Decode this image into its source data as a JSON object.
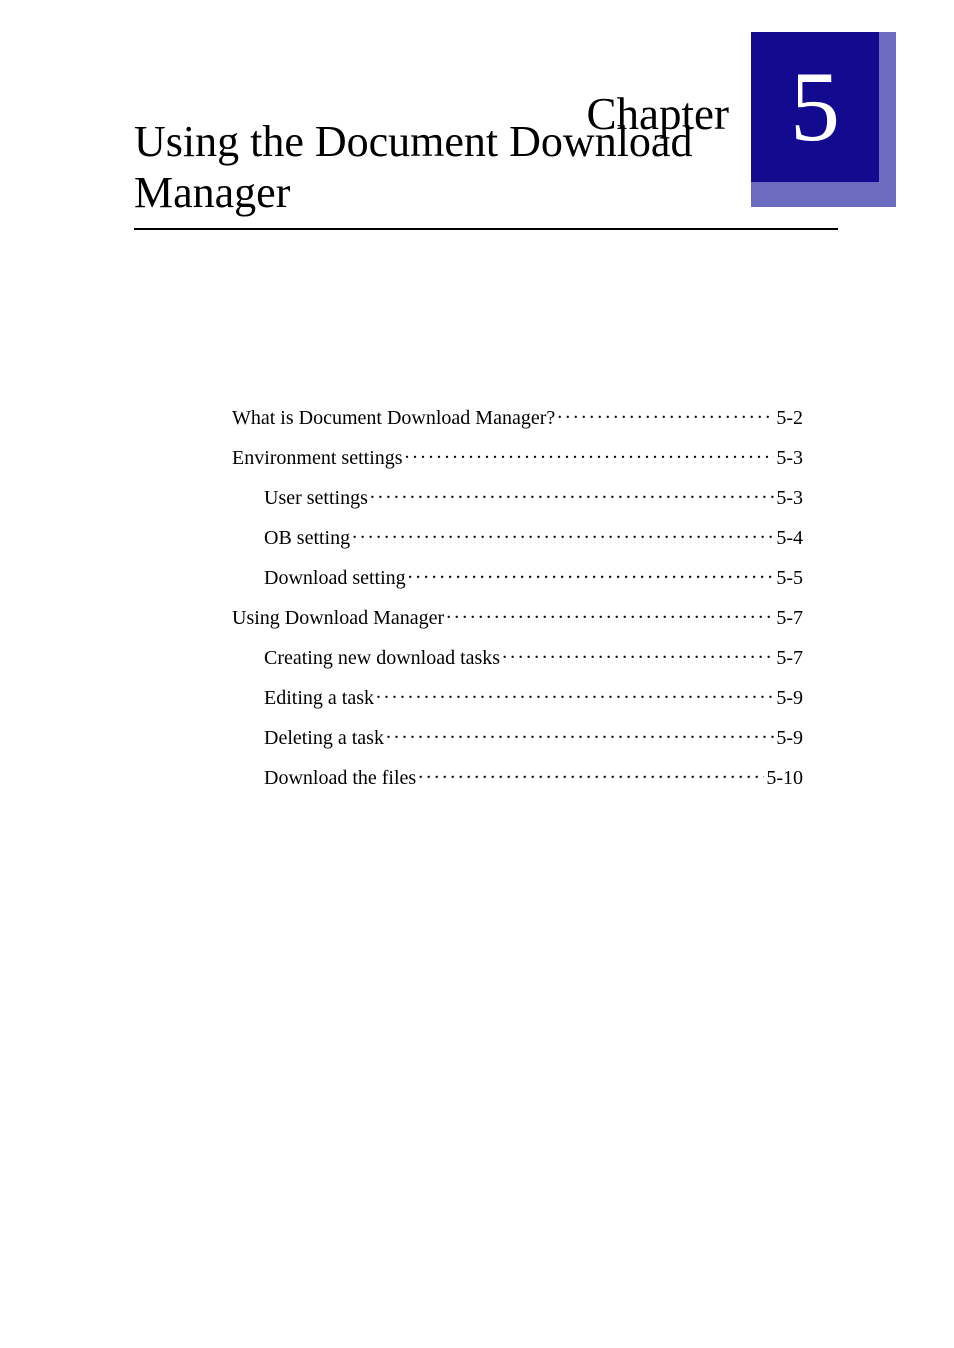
{
  "chapter": {
    "label": "Chapter",
    "number": "5",
    "title": "Using the Document Download Manager"
  },
  "toc": [
    {
      "label": "What is Document Download Manager?",
      "page": "5-2",
      "level": 0
    },
    {
      "label": "Environment settings",
      "page": "5-3",
      "level": 0
    },
    {
      "label": "User settings",
      "page": "5-3",
      "level": 1
    },
    {
      "label": "OB setting",
      "page": "5-4",
      "level": 1
    },
    {
      "label": "Download setting",
      "page": "5-5",
      "level": 1
    },
    {
      "label": "Using Download Manager",
      "page": "5-7",
      "level": 0
    },
    {
      "label": "Creating new download tasks",
      "page": "5-7",
      "level": 1
    },
    {
      "label": "Editing a task",
      "page": "5-9",
      "level": 1
    },
    {
      "label": "Deleting a task",
      "page": "5-9",
      "level": 1
    },
    {
      "label": "Download the files",
      "page": "5-10",
      "level": 1
    }
  ]
}
